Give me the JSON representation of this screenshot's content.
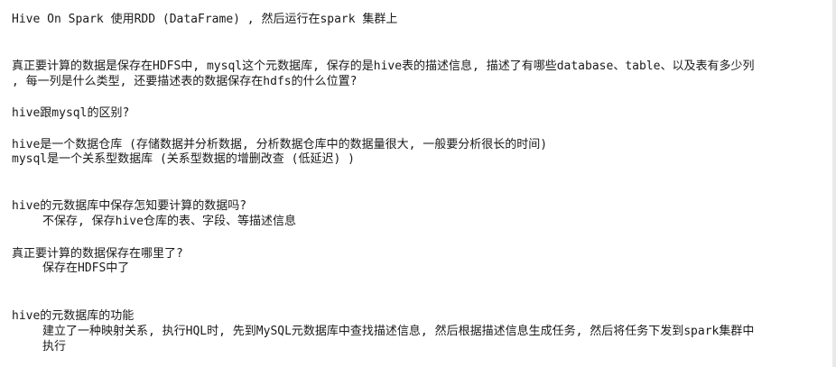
{
  "lines": [
    "Hive On Spark 使用RDD (DataFrame) , 然后运行在spark 集群上",
    "真正要计算的数据是保存在HDFS中, mysql这个元数据库, 保存的是hive表的描述信息, 描述了有哪些database、table、以及表有多少列",
    ", 每一列是什么类型, 还要描述表的数据保存在hdfs的什么位置?",
    "hive跟mysql的区别?",
    "hive是一个数据仓库 (存储数据并分析数据, 分析数据仓库中的数据量很大, 一般要分析很长的时间)",
    "mysql是一个关系型数据库 (关系型数据的增删改查 (低延迟) )",
    "hive的元数据库中保存怎知要计算的数据吗?",
    "不保存, 保存hive仓库的表、字段、等描述信息",
    "真正要计算的数据保存在哪里了?",
    "保存在HDFS中了",
    "hive的元数据库的功能",
    "建立了一种映射关系, 执行HQL时, 先到MySQL元数据库中查找描述信息, 然后根据描述信息生成任务, 然后将任务下发到spark集群中",
    "执行"
  ]
}
